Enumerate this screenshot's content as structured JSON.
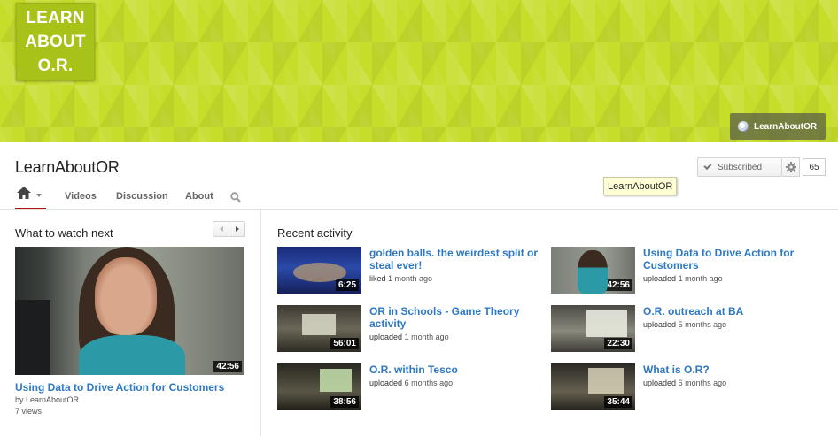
{
  "banner": {
    "logo_text": "LEARN\nABOUT\nO.R.",
    "link_label": "LearnAboutOR"
  },
  "channel": {
    "title": "LearnAboutOR",
    "tabs": [
      {
        "label": "Videos"
      },
      {
        "label": "Discussion"
      },
      {
        "label": "About"
      }
    ],
    "subscribe_label": "Subscribed",
    "subscriber_count": "65",
    "tooltip": "LearnAboutOR"
  },
  "what_to_watch": {
    "heading": "What to watch next",
    "featured": {
      "title": "Using Data to Drive Action for Customers",
      "by": "by LearnAboutOR",
      "views": "7 views",
      "duration": "42:56"
    }
  },
  "recent": {
    "heading": "Recent activity",
    "items": [
      {
        "title": "golden balls. the weirdest split or steal ever!",
        "action": "liked",
        "time": "1 month ago",
        "duration": "6:25"
      },
      {
        "title": "Using Data to Drive Action for Customers",
        "action": "uploaded",
        "time": "1 month ago",
        "duration": "42:56"
      },
      {
        "title": "OR in Schools - Game Theory activity",
        "action": "uploaded",
        "time": "1 month ago",
        "duration": "56:01"
      },
      {
        "title": "O.R. outreach at BA",
        "action": "uploaded",
        "time": "5 months ago",
        "duration": "22:30"
      },
      {
        "title": "O.R. within Tesco",
        "action": "uploaded",
        "time": "6 months ago",
        "duration": "38:56"
      },
      {
        "title": "What is O.R?",
        "action": "uploaded",
        "time": "6 months ago",
        "duration": "35:44"
      }
    ]
  },
  "colors": {
    "banner": "#c6dd2a",
    "logo_box": "#a9c21a",
    "link": "#2f78c4",
    "active_tab": "#b31217"
  }
}
